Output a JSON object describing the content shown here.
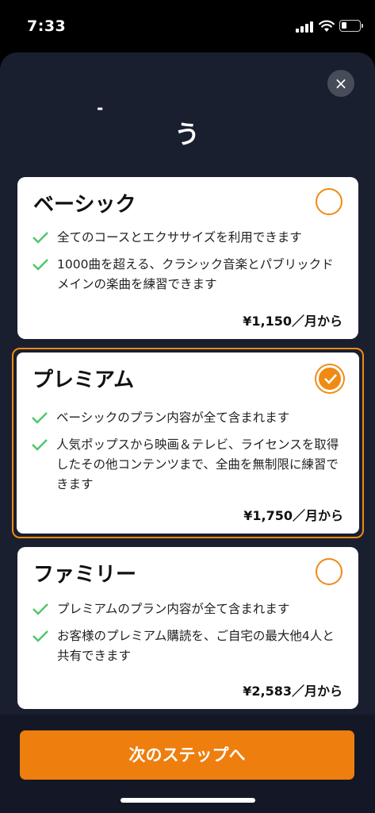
{
  "status_bar": {
    "time": "7:33"
  },
  "sheet": {
    "close_icon": "×",
    "heading_fragment_1": "-",
    "heading_fragment_2": "う"
  },
  "plans": [
    {
      "title": "ベーシック",
      "selected": false,
      "features": [
        "全てのコースとエクササイズを利用できます",
        "1000曲を超える、クラシック音楽とパブリックドメインの楽曲を練習できます"
      ],
      "price": "¥1,150／月から"
    },
    {
      "title": "プレミアム",
      "selected": true,
      "features": [
        "ベーシックのプラン内容が全て含まれます",
        "人気ポップスから映画＆テレビ、ライセンスを取得したその他コンテンツまで、全曲を無制限に練習できます"
      ],
      "price": "¥1,750／月から"
    },
    {
      "title": "ファミリー",
      "selected": false,
      "features": [
        "プレミアムのプラン内容が全て含まれます",
        "お客様のプレミアム購読を、ご自宅の最大他4人と共有できます"
      ],
      "price": "¥2,583／月から"
    }
  ],
  "cta": {
    "label": "次のステップへ"
  },
  "colors": {
    "accent": "#ee7e0e",
    "check": "#4cc76a",
    "sheet_bg": "#1a1f2f"
  }
}
